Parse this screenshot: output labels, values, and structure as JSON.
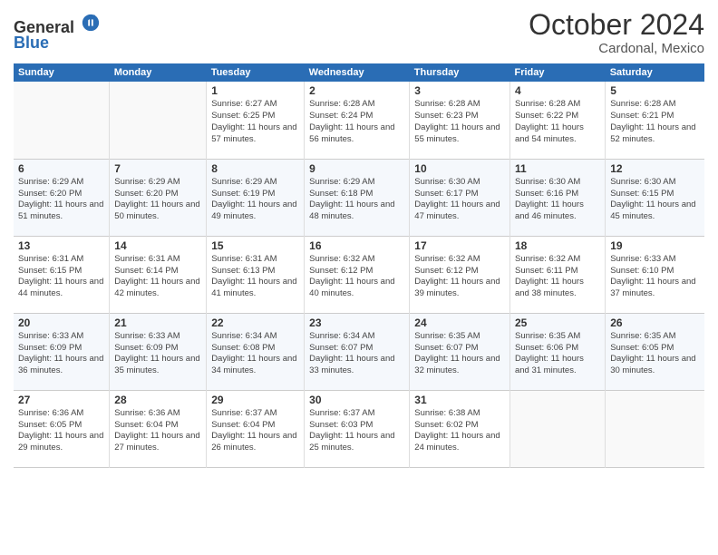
{
  "header": {
    "logo_line1": "General",
    "logo_line2": "Blue",
    "month_title": "October 2024",
    "location": "Cardonal, Mexico"
  },
  "weekdays": [
    "Sunday",
    "Monday",
    "Tuesday",
    "Wednesday",
    "Thursday",
    "Friday",
    "Saturday"
  ],
  "weeks": [
    [
      {
        "day": "",
        "info": ""
      },
      {
        "day": "",
        "info": ""
      },
      {
        "day": "1",
        "info": "Sunrise: 6:27 AM\nSunset: 6:25 PM\nDaylight: 11 hours and 57 minutes."
      },
      {
        "day": "2",
        "info": "Sunrise: 6:28 AM\nSunset: 6:24 PM\nDaylight: 11 hours and 56 minutes."
      },
      {
        "day": "3",
        "info": "Sunrise: 6:28 AM\nSunset: 6:23 PM\nDaylight: 11 hours and 55 minutes."
      },
      {
        "day": "4",
        "info": "Sunrise: 6:28 AM\nSunset: 6:22 PM\nDaylight: 11 hours and 54 minutes."
      },
      {
        "day": "5",
        "info": "Sunrise: 6:28 AM\nSunset: 6:21 PM\nDaylight: 11 hours and 52 minutes."
      }
    ],
    [
      {
        "day": "6",
        "info": "Sunrise: 6:29 AM\nSunset: 6:20 PM\nDaylight: 11 hours and 51 minutes."
      },
      {
        "day": "7",
        "info": "Sunrise: 6:29 AM\nSunset: 6:20 PM\nDaylight: 11 hours and 50 minutes."
      },
      {
        "day": "8",
        "info": "Sunrise: 6:29 AM\nSunset: 6:19 PM\nDaylight: 11 hours and 49 minutes."
      },
      {
        "day": "9",
        "info": "Sunrise: 6:29 AM\nSunset: 6:18 PM\nDaylight: 11 hours and 48 minutes."
      },
      {
        "day": "10",
        "info": "Sunrise: 6:30 AM\nSunset: 6:17 PM\nDaylight: 11 hours and 47 minutes."
      },
      {
        "day": "11",
        "info": "Sunrise: 6:30 AM\nSunset: 6:16 PM\nDaylight: 11 hours and 46 minutes."
      },
      {
        "day": "12",
        "info": "Sunrise: 6:30 AM\nSunset: 6:15 PM\nDaylight: 11 hours and 45 minutes."
      }
    ],
    [
      {
        "day": "13",
        "info": "Sunrise: 6:31 AM\nSunset: 6:15 PM\nDaylight: 11 hours and 44 minutes."
      },
      {
        "day": "14",
        "info": "Sunrise: 6:31 AM\nSunset: 6:14 PM\nDaylight: 11 hours and 42 minutes."
      },
      {
        "day": "15",
        "info": "Sunrise: 6:31 AM\nSunset: 6:13 PM\nDaylight: 11 hours and 41 minutes."
      },
      {
        "day": "16",
        "info": "Sunrise: 6:32 AM\nSunset: 6:12 PM\nDaylight: 11 hours and 40 minutes."
      },
      {
        "day": "17",
        "info": "Sunrise: 6:32 AM\nSunset: 6:12 PM\nDaylight: 11 hours and 39 minutes."
      },
      {
        "day": "18",
        "info": "Sunrise: 6:32 AM\nSunset: 6:11 PM\nDaylight: 11 hours and 38 minutes."
      },
      {
        "day": "19",
        "info": "Sunrise: 6:33 AM\nSunset: 6:10 PM\nDaylight: 11 hours and 37 minutes."
      }
    ],
    [
      {
        "day": "20",
        "info": "Sunrise: 6:33 AM\nSunset: 6:09 PM\nDaylight: 11 hours and 36 minutes."
      },
      {
        "day": "21",
        "info": "Sunrise: 6:33 AM\nSunset: 6:09 PM\nDaylight: 11 hours and 35 minutes."
      },
      {
        "day": "22",
        "info": "Sunrise: 6:34 AM\nSunset: 6:08 PM\nDaylight: 11 hours and 34 minutes."
      },
      {
        "day": "23",
        "info": "Sunrise: 6:34 AM\nSunset: 6:07 PM\nDaylight: 11 hours and 33 minutes."
      },
      {
        "day": "24",
        "info": "Sunrise: 6:35 AM\nSunset: 6:07 PM\nDaylight: 11 hours and 32 minutes."
      },
      {
        "day": "25",
        "info": "Sunrise: 6:35 AM\nSunset: 6:06 PM\nDaylight: 11 hours and 31 minutes."
      },
      {
        "day": "26",
        "info": "Sunrise: 6:35 AM\nSunset: 6:05 PM\nDaylight: 11 hours and 30 minutes."
      }
    ],
    [
      {
        "day": "27",
        "info": "Sunrise: 6:36 AM\nSunset: 6:05 PM\nDaylight: 11 hours and 29 minutes."
      },
      {
        "day": "28",
        "info": "Sunrise: 6:36 AM\nSunset: 6:04 PM\nDaylight: 11 hours and 27 minutes."
      },
      {
        "day": "29",
        "info": "Sunrise: 6:37 AM\nSunset: 6:04 PM\nDaylight: 11 hours and 26 minutes."
      },
      {
        "day": "30",
        "info": "Sunrise: 6:37 AM\nSunset: 6:03 PM\nDaylight: 11 hours and 25 minutes."
      },
      {
        "day": "31",
        "info": "Sunrise: 6:38 AM\nSunset: 6:02 PM\nDaylight: 11 hours and 24 minutes."
      },
      {
        "day": "",
        "info": ""
      },
      {
        "day": "",
        "info": ""
      }
    ]
  ]
}
